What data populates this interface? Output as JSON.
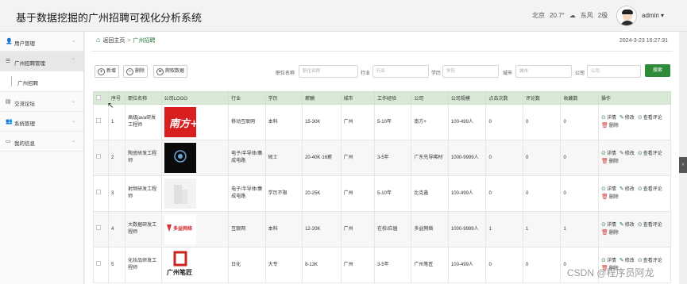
{
  "app": {
    "title": "基于数据挖掘的广州招聘可视化分析系统"
  },
  "header": {
    "weather": {
      "city": "北京",
      "temp": "20.7°",
      "wind": "东风",
      "level": "2级"
    },
    "user": "admin ▾"
  },
  "sidebar": {
    "items": [
      {
        "label": "用户管理",
        "icon": "user-icon"
      },
      {
        "label": "广州招聘管理",
        "icon": "list-icon"
      },
      {
        "label": "广州招聘",
        "icon": ""
      },
      {
        "label": "交流论坛",
        "icon": "forum-icon"
      },
      {
        "label": "系统管理",
        "icon": "gear-icon"
      },
      {
        "label": "我的信息",
        "icon": "profile-icon"
      }
    ]
  },
  "breadcrumb": {
    "home": "返回主页",
    "current": "广州招聘"
  },
  "datetime": "2024-3-23 16:27:31",
  "toolbar": {
    "add": "新增",
    "delete": "删除",
    "fetch": "爬取数据"
  },
  "filters": {
    "job": {
      "label": "职位名称",
      "placeholder": "职位名称"
    },
    "industry": {
      "label": "行业",
      "placeholder": "行业"
    },
    "edu": {
      "label": "学历",
      "placeholder": "学历"
    },
    "city": {
      "label": "城市",
      "placeholder": "城市"
    },
    "company": {
      "label": "公司",
      "placeholder": "公司"
    },
    "search": "搜索"
  },
  "table": {
    "headers": [
      "序号",
      "职位名称",
      "公司LOGO",
      "行业",
      "学历",
      "薪酬",
      "城市",
      "工作经验",
      "公司",
      "公司规模",
      "点击次数",
      "评论数",
      "收藏数",
      "操作"
    ],
    "rows": [
      {
        "no": "1",
        "job": "高级java研发工程师",
        "industry": "移动互联网",
        "edu": "本科",
        "salary": "15-30K",
        "city": "广州",
        "exp": "5-10年",
        "company": "南方+",
        "size": "100-499人",
        "clicks": "0",
        "comments": "0",
        "favs": "0"
      },
      {
        "no": "2",
        "job": "陶瓷研发工程师",
        "industry": "电子/半导体/集成电路",
        "edu": "硕士",
        "salary": "20-40K·16薪",
        "city": "广州",
        "exp": "3-5年",
        "company": "广东先导稀材",
        "size": "1000-9999人",
        "clicks": "0",
        "comments": "0",
        "favs": "0"
      },
      {
        "no": "3",
        "job": "射频研发工程师",
        "industry": "电子/半导体/集成电路",
        "edu": "学历不限",
        "salary": "20-25K",
        "city": "广州",
        "exp": "5-10年",
        "company": "比克鑫",
        "size": "100-499人",
        "clicks": "0",
        "comments": "0",
        "favs": "0"
      },
      {
        "no": "4",
        "job": "大数据研发工程师",
        "industry": "互联网",
        "edu": "本科",
        "salary": "12-20K",
        "city": "广州",
        "exp": "在校/应届",
        "company": "多益网络",
        "size": "1000-9999人",
        "clicks": "1",
        "comments": "1",
        "favs": "1"
      },
      {
        "no": "5",
        "job": "化妆品研发工程师",
        "industry": "日化",
        "edu": "大专",
        "salary": "8-13K",
        "city": "广州",
        "exp": "3-5年",
        "company": "广州笔匠",
        "size": "100-499人",
        "clicks": "0",
        "comments": "0",
        "favs": "0"
      }
    ],
    "logos": [
      {
        "text": "南方+",
        "bg": "#d81e1e"
      },
      {
        "text": "",
        "bg": "#0b0b0b"
      },
      {
        "text": "",
        "bg": "#f2f2f2"
      },
      {
        "text": "多益网络",
        "bg": "#ffffff"
      },
      {
        "text": "广州笔匠",
        "bg": "#ffffff"
      }
    ],
    "actions": {
      "detail": "详情",
      "edit": "修改",
      "comments": "查看评论",
      "delete": "删除"
    }
  },
  "watermark": "CSDN @程序员阿龙",
  "colors": {
    "accent": "#2f8a3a",
    "header_row": "#d8e9d5"
  }
}
